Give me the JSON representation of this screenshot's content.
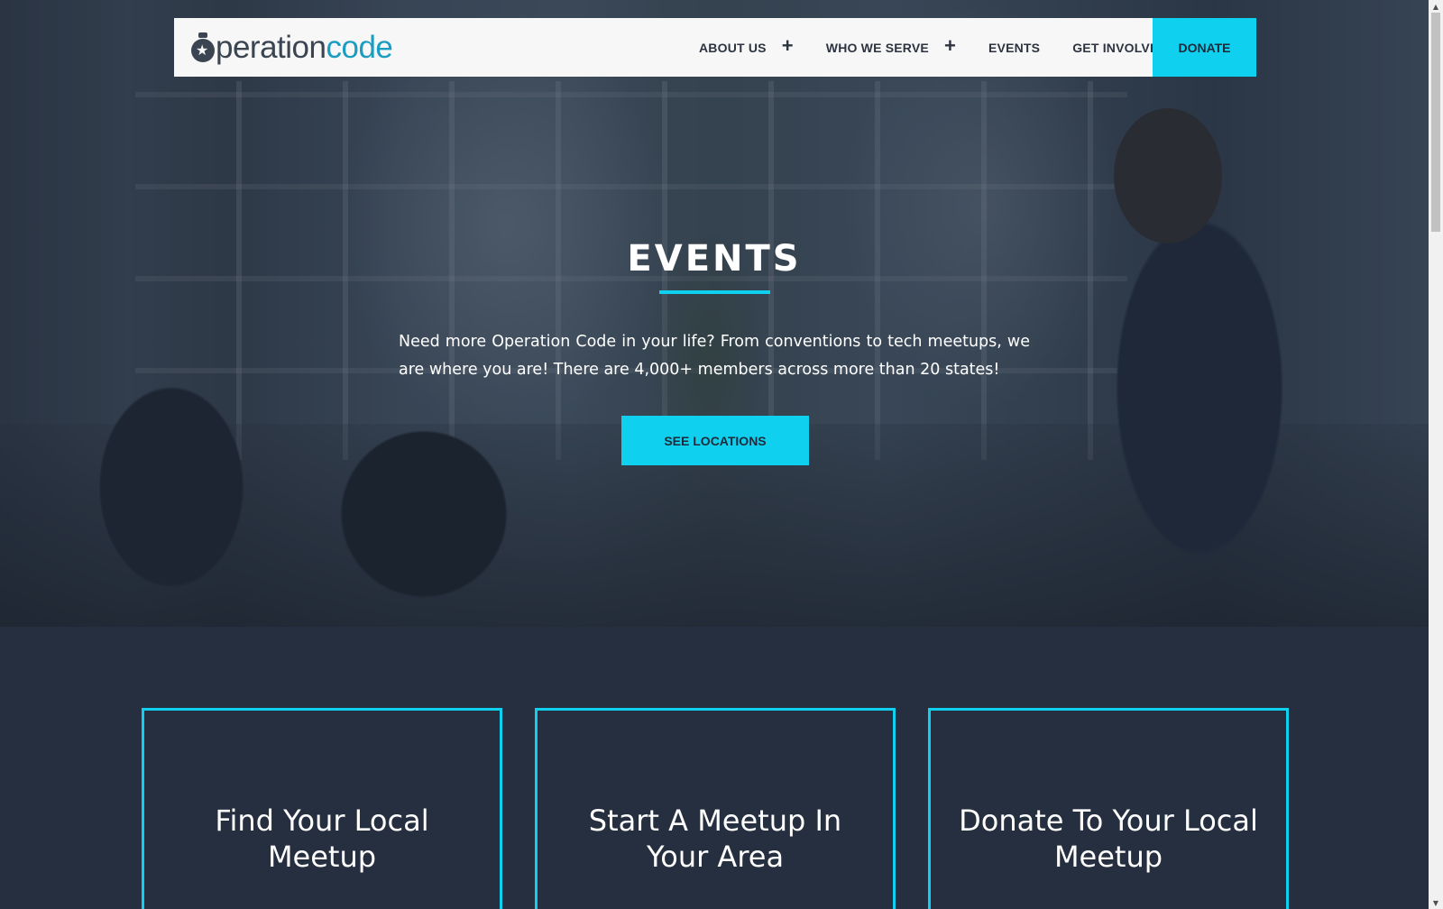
{
  "header": {
    "logo": {
      "prefix": "peration",
      "suffix": "code",
      "icon": "medal-star-icon"
    },
    "nav": [
      {
        "label": "ABOUT US",
        "has_submenu": true
      },
      {
        "label": "WHO WE SERVE",
        "has_submenu": true
      },
      {
        "label": "EVENTS",
        "has_submenu": false
      },
      {
        "label": "GET INVOLVED",
        "has_submenu": true
      }
    ],
    "submenu_icon": "+",
    "donate_label": "DONATE"
  },
  "hero": {
    "title": "EVENTS",
    "description": "Need more Operation Code in your life? From conventions to tech meetups, we are where you are! There are 4,000+ members across more than 20 states!",
    "cta_label": "SEE LOCATIONS"
  },
  "cards": [
    {
      "title": "Find Your Local Meetup"
    },
    {
      "title": "Start A Meetup In Your Area"
    },
    {
      "title": "Donate To Your Local Meetup"
    }
  ],
  "colors": {
    "accent": "#0fd1ef",
    "dark_bg": "#252f3f",
    "logo_dark": "#3b4552",
    "logo_blue": "#1b9dc2"
  },
  "scrollbar": {
    "up_arrow": "▲",
    "down_arrow": "▼"
  }
}
